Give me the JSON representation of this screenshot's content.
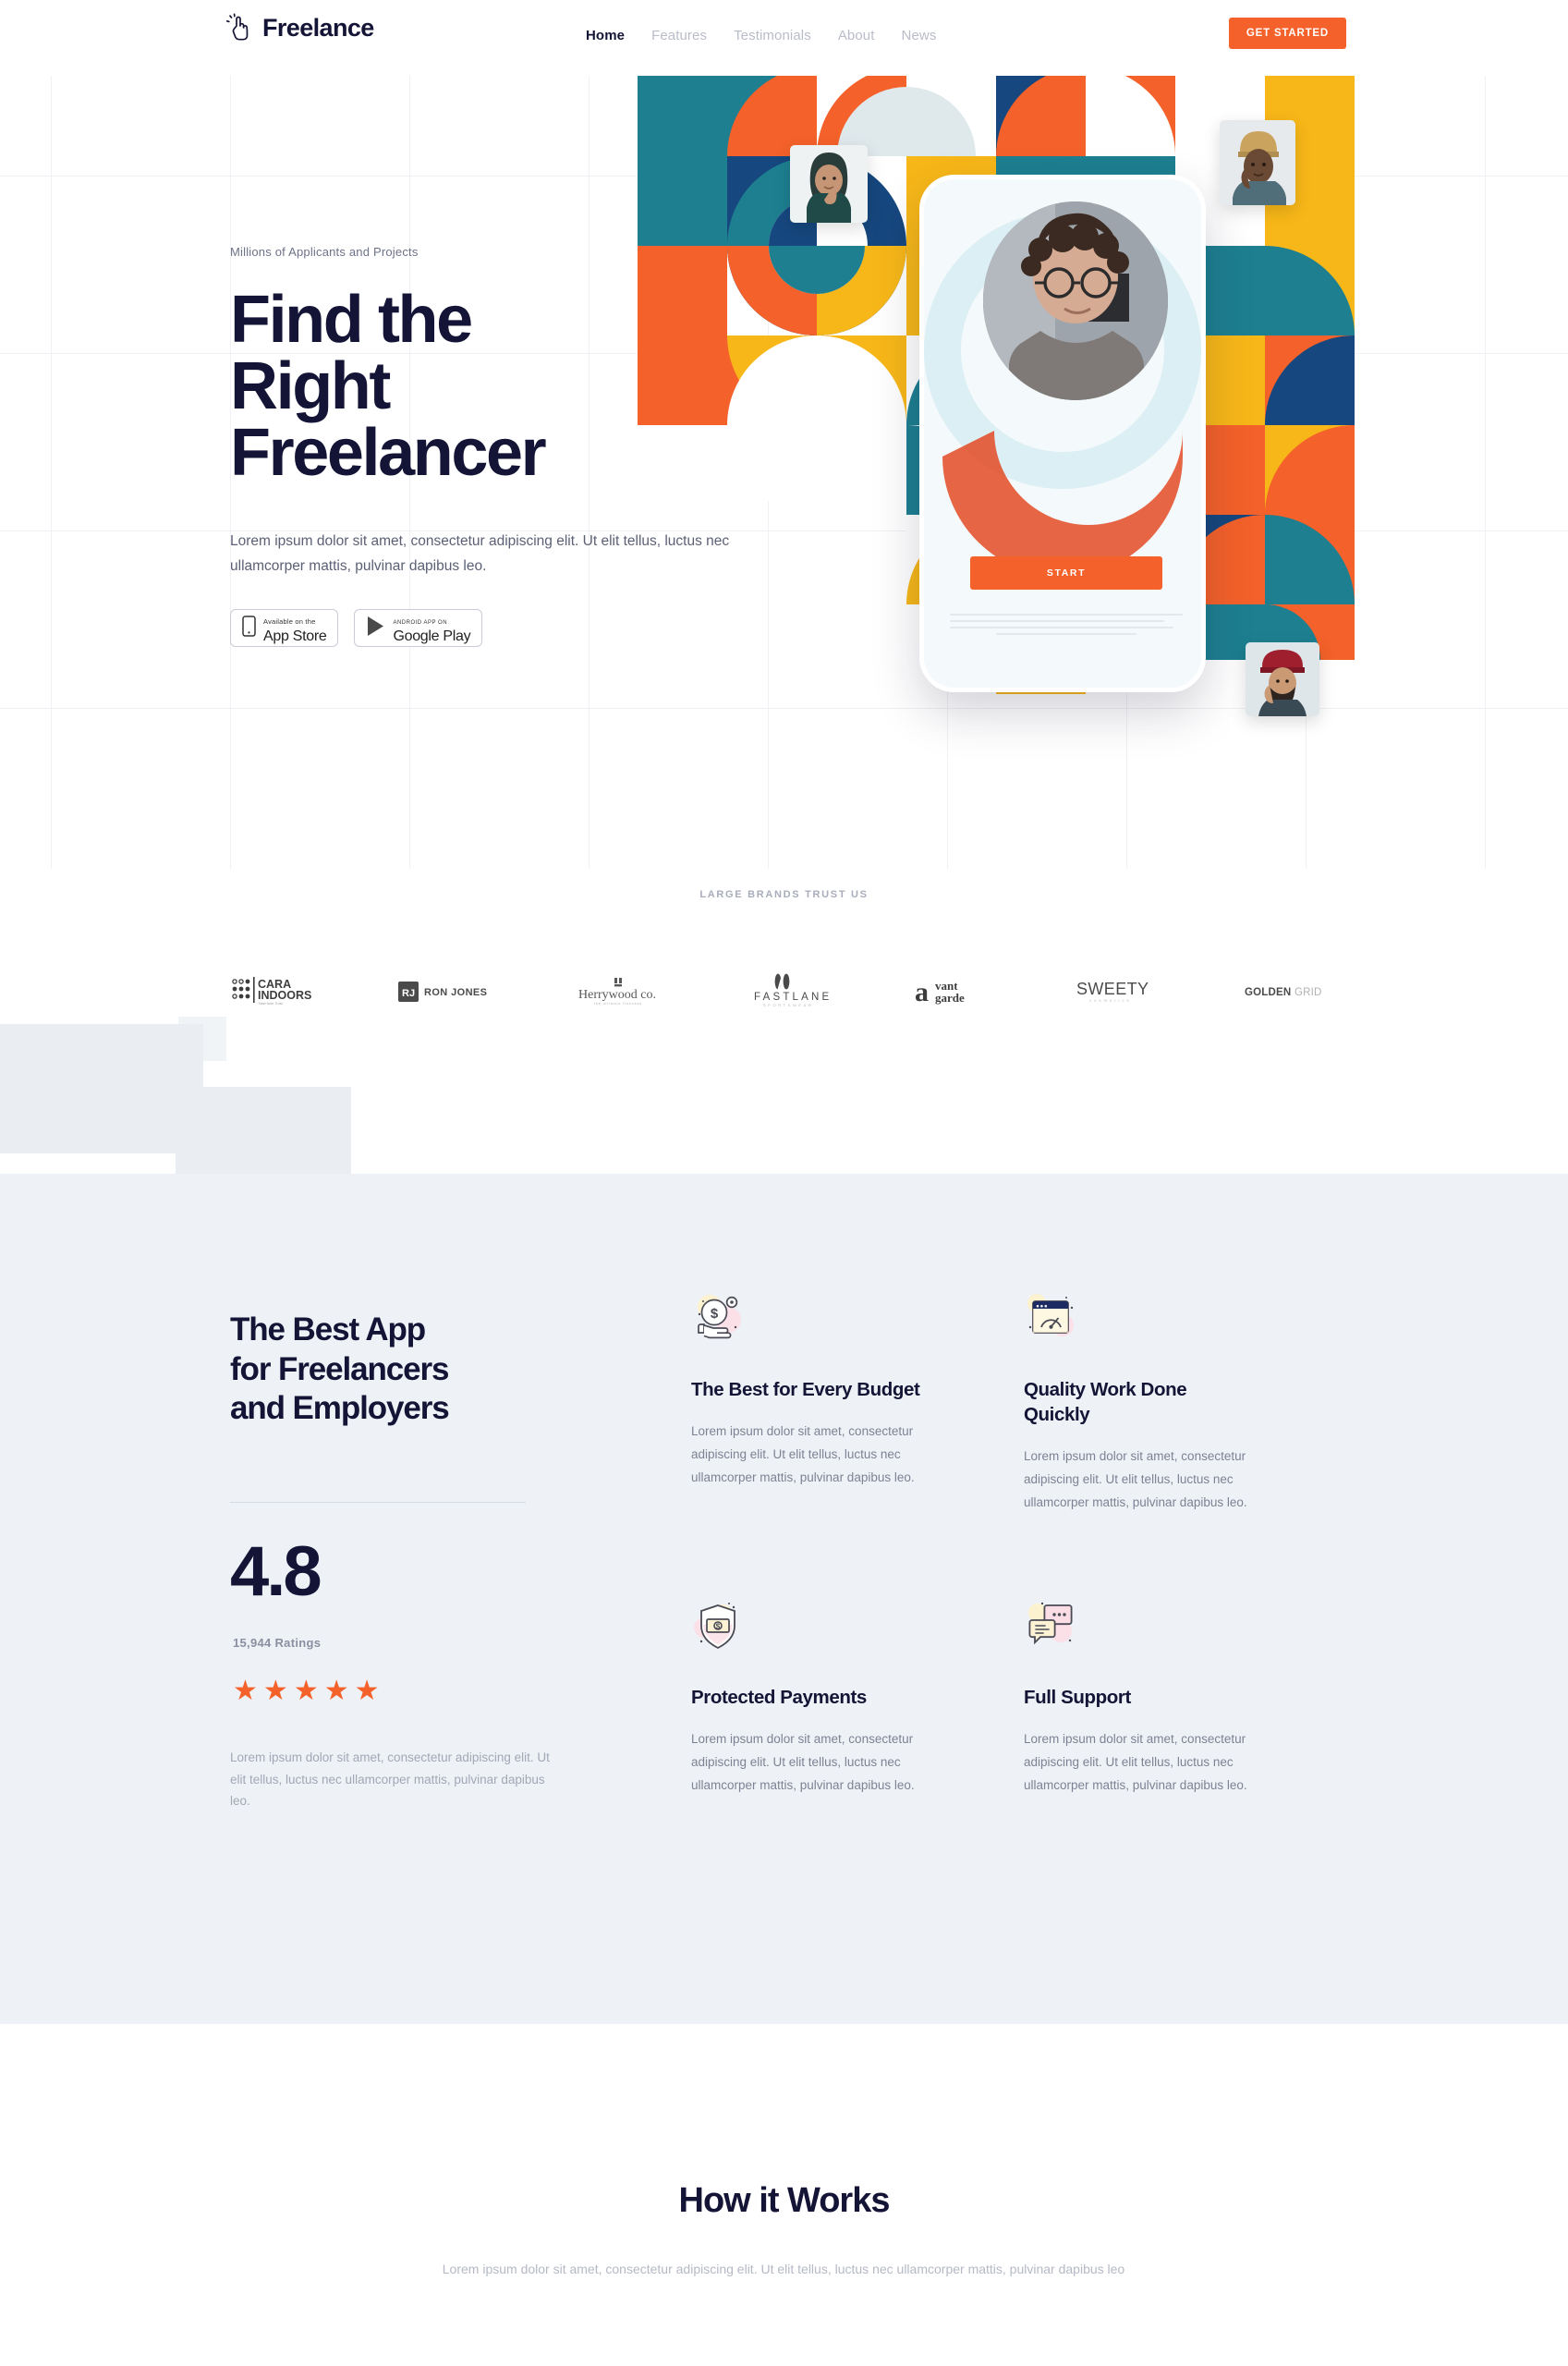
{
  "header": {
    "logo_text": "Freelance",
    "logo_icon": "pointing-hand-icon",
    "nav": [
      {
        "label": "Home",
        "active": true
      },
      {
        "label": "Features",
        "active": false
      },
      {
        "label": "Testimonials",
        "active": false
      },
      {
        "label": "About",
        "active": false
      },
      {
        "label": "News",
        "active": false
      }
    ],
    "cta_label": "GET STARTED"
  },
  "hero": {
    "eyebrow": "Millions of Applicants and Projects",
    "headline_line1": "Find the",
    "headline_line2": "Right",
    "headline_line3": "Freelancer",
    "paragraph": "Lorem ipsum dolor sit amet, consectetur adipiscing elit. Ut elit tellus, luctus nec ullamcorper mattis, pulvinar dapibus leo.",
    "badges": [
      {
        "sub": "Available on the",
        "main": "App Store",
        "icon": "apple-phone-icon"
      },
      {
        "sub": "ANDROID APP ON",
        "main": "Google Play",
        "icon": "google-play-triangle-icon"
      }
    ],
    "phone_button": "START",
    "colors": {
      "teal": "#1d7f90",
      "orange": "#f4612a",
      "yellow": "#f7b718",
      "navy": "#16477e",
      "white": "#ffffff",
      "accent": "#f4612a",
      "ink": "#141436"
    }
  },
  "brands": {
    "label": "LARGE BRANDS TRUST US",
    "items": [
      {
        "name": "CARA INDOORS",
        "tagline": "New from Trust"
      },
      {
        "name": "RON JONES",
        "mark": "RJ"
      },
      {
        "name": "Herrywood co.",
        "tagline": "the ultimate fineness"
      },
      {
        "name": "FASTLANE",
        "tagline": "SPORTSWEAR"
      },
      {
        "name": "avant garde",
        "mark": "a"
      },
      {
        "name": "SWEETY",
        "tagline": "cosmetics"
      },
      {
        "name": "GOLDENGRID",
        "bold_part": "GOLDEN",
        "light_part": "GRID"
      }
    ]
  },
  "features": {
    "heading_line1": "The Best App",
    "heading_line2": "for Freelancers",
    "heading_line3": "and Employers",
    "score": "4.8",
    "ratings_count": "15,944 Ratings",
    "stars": 5,
    "star_color": "#f4612a",
    "note": "Lorem ipsum dolor sit amet, consectetur adipiscing elit. Ut elit tellus, luctus nec ullamcorper mattis, pulvinar dapibus leo.",
    "cards": [
      {
        "icon": "money-in-hand-icon",
        "title": "The Best for Every Budget",
        "body": "Lorem ipsum dolor sit amet, consectetur adipiscing elit. Ut elit tellus, luctus nec ullamcorper mattis, pulvinar dapibus leo."
      },
      {
        "icon": "browser-speedometer-icon",
        "title": "Quality Work Done Quickly",
        "body": "Lorem ipsum dolor sit amet, consectetur adipiscing elit. Ut elit tellus, luctus nec ullamcorper mattis, pulvinar dapibus leo."
      },
      {
        "icon": "shield-money-icon",
        "title": "Protected Payments",
        "body": "Lorem ipsum dolor sit amet, consectetur adipiscing elit. Ut elit tellus, luctus nec ullamcorper mattis, pulvinar dapibus leo."
      },
      {
        "icon": "chat-bubbles-icon",
        "title": "Full Support",
        "body": "Lorem ipsum dolor sit amet, consectetur adipiscing elit. Ut elit tellus, luctus nec ullamcorper mattis, pulvinar dapibus leo."
      }
    ]
  },
  "how_it_works": {
    "title": "How it Works",
    "subtitle": "Lorem ipsum dolor sit amet, consectetur adipiscing elit. Ut elit tellus, luctus nec ullamcorper mattis, pulvinar dapibus leo"
  }
}
